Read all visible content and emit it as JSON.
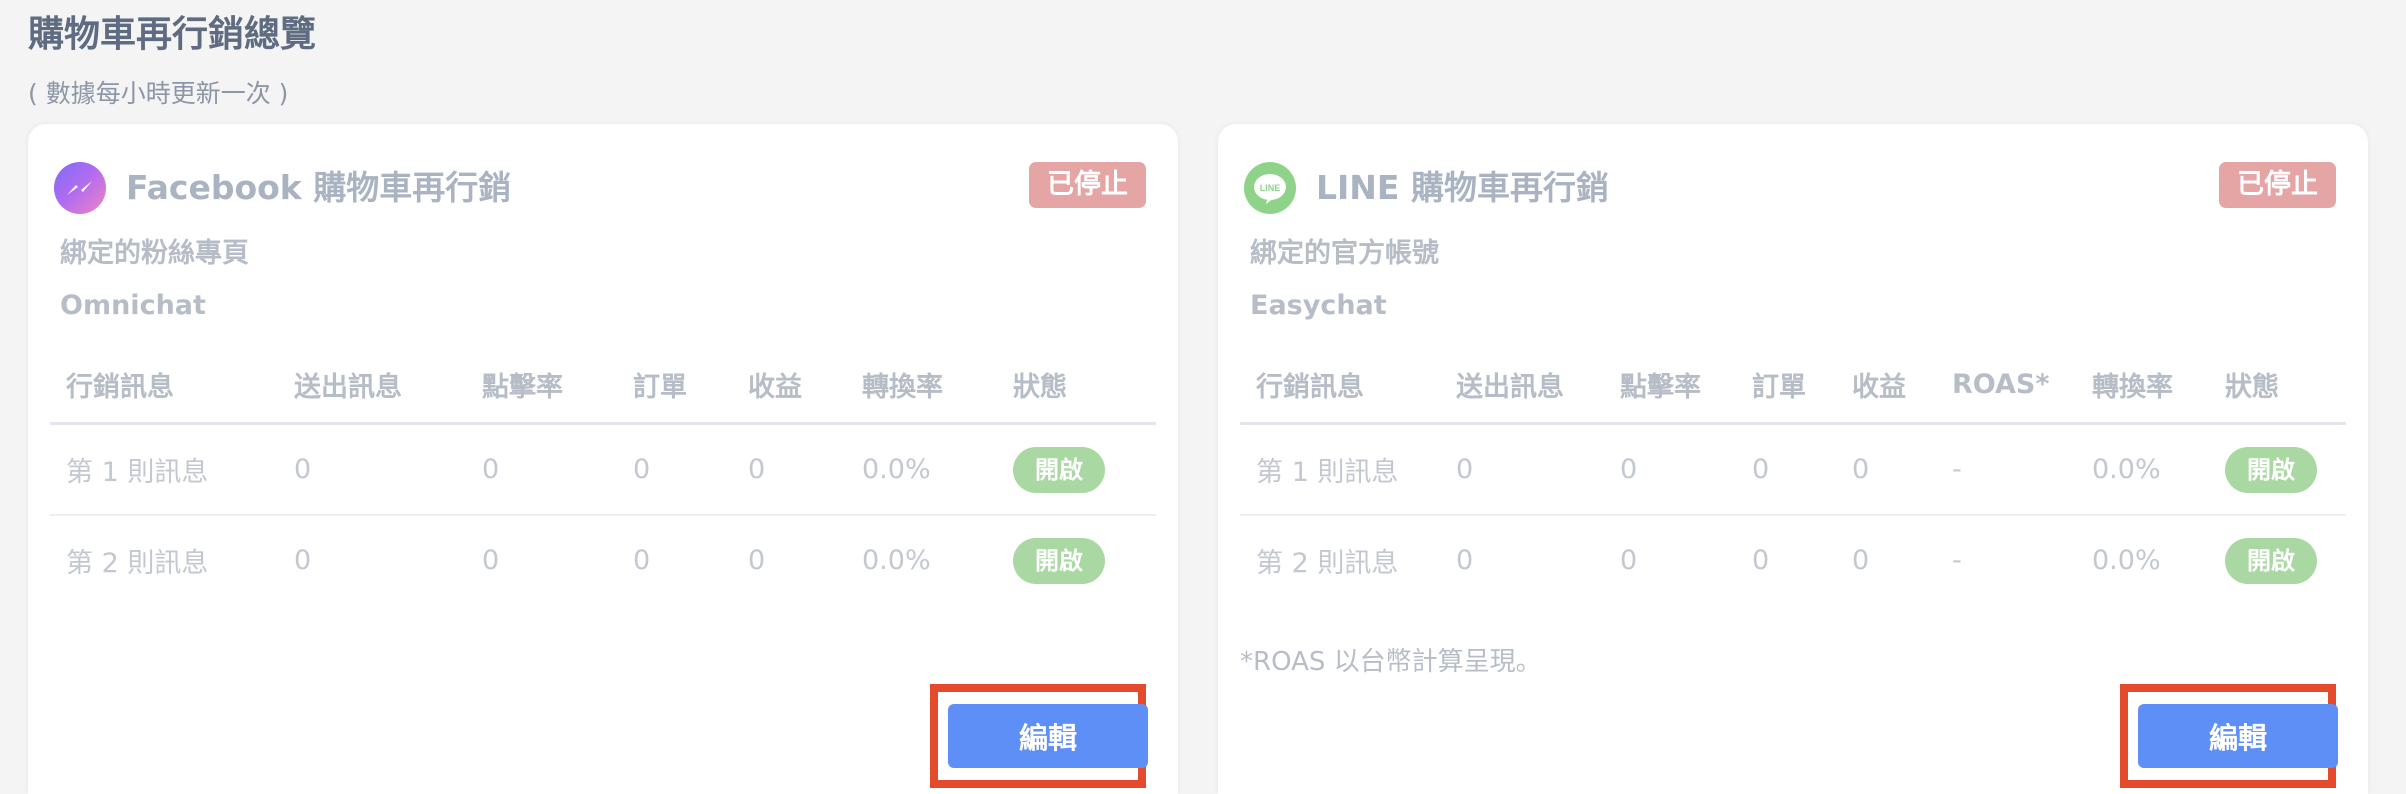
{
  "page": {
    "title": "購物車再行銷總覽",
    "subtitle": "( 數據每小時更新一次 )"
  },
  "facebook": {
    "icon": "messenger-icon",
    "title": "Facebook 購物車再行銷",
    "status": "已停止",
    "bind_label": "綁定的粉絲專頁",
    "bind_value": "Omnichat",
    "columns": [
      "行銷訊息",
      "送出訊息",
      "點擊率",
      "訂單",
      "收益",
      "轉換率",
      "狀態"
    ],
    "rows": [
      {
        "message": "第 1 則訊息",
        "sent": "0",
        "ctr": "0",
        "orders": "0",
        "revenue": "0",
        "conversion": "0.0%",
        "state": "開啟"
      },
      {
        "message": "第 2 則訊息",
        "sent": "0",
        "ctr": "0",
        "orders": "0",
        "revenue": "0",
        "conversion": "0.0%",
        "state": "開啟"
      }
    ],
    "edit_label": "編輯"
  },
  "line": {
    "icon": "line-icon",
    "icon_text": "LINE",
    "title": "LINE 購物車再行銷",
    "status": "已停止",
    "bind_label": "綁定的官方帳號",
    "bind_value": "Easychat",
    "columns": [
      "行銷訊息",
      "送出訊息",
      "點擊率",
      "訂單",
      "收益",
      "ROAS*",
      "轉換率",
      "狀態"
    ],
    "rows": [
      {
        "message": "第 1 則訊息",
        "sent": "0",
        "ctr": "0",
        "orders": "0",
        "revenue": "0",
        "roas": "-",
        "conversion": "0.0%",
        "state": "開啟"
      },
      {
        "message": "第 2 則訊息",
        "sent": "0",
        "ctr": "0",
        "orders": "0",
        "revenue": "0",
        "roas": "-",
        "conversion": "0.0%",
        "state": "開啟"
      }
    ],
    "note": "*ROAS 以台幣計算呈現。",
    "edit_label": "編輯"
  },
  "colors": {
    "accent": "#5d8ff6",
    "stopped_badge": "#e6a5a5",
    "enabled_pill": "#a9d8a2",
    "highlight": "#e34b2c"
  }
}
